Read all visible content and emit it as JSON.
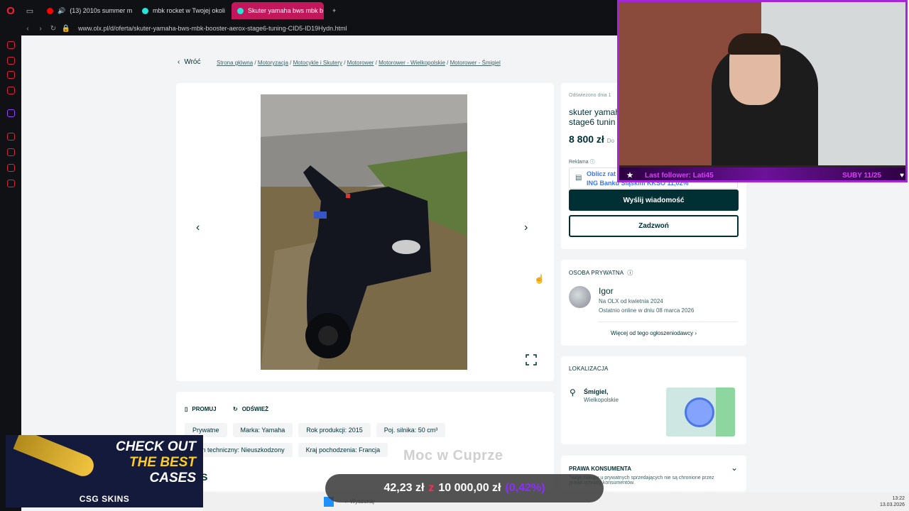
{
  "browser": {
    "tabs": [
      {
        "label": "(13) 2010s summer m",
        "color": "#ff0000",
        "active": false
      },
      {
        "label": "mbk rocket w Twojej okoli",
        "color": "#23e5db",
        "active": false
      },
      {
        "label": "Skuter yamaha bws mbk b",
        "color": "#23e5db",
        "active": true
      }
    ],
    "new_tab": "+",
    "url": "www.olx.pl/d/oferta/skuter-yamaha-bws-mbk-booster-aerox-stage6-tuning-CID5-ID19Hydn.html"
  },
  "listing": {
    "back": "Wróć",
    "breadcrumbs": [
      "Strona główna",
      "Motoryzacja",
      "Motocykle i Skutery",
      "Motorower",
      "Motorower - Wielkopolskie",
      "Motorower - Śmigiel"
    ],
    "refreshed": "Odświeżono dnia 1",
    "title": "skuter yamaha stage6 tunin",
    "price": "8 800 zł",
    "price_suffix": "Do",
    "ad_label": "Reklama",
    "ad_line1": "Oblicz rat",
    "ad_line2": "ING Banku Śląskim KKSO 11,02%",
    "send_message": "Wyślij wiadomość",
    "call": "Zadzwoń",
    "promote": "PROMUJ",
    "refresh": "ODŚWIEŻ",
    "tags": [
      "Prywatne",
      "Marka: Yamaha",
      "Rok produkcji: 2015",
      "Poj. silnika: 50 cm³",
      "Stan techniczny: Nieuszkodzony",
      "Kraj pochodzenia: Francja"
    ],
    "section_s": "S"
  },
  "seller": {
    "heading": "OSOBA PRYWATNA",
    "name": "Igor",
    "since": "Na OLX od kwietnia 2024",
    "online": "Ostatnio online w dniu 08 marca 2026",
    "more": "Więcej od tego ogłoszeniodawcy"
  },
  "location": {
    "heading": "LOKALIZACJA",
    "city": "Śmigiel,",
    "region": "Wielkopolskie"
  },
  "consumer": {
    "heading": "PRAWA KONSUMENTA",
    "text": "Twoje zakupy u prywatnych sprzedających nie są chronione przez prawa ochrony konsumentów."
  },
  "stream": {
    "follower": "Last follower: Lati45",
    "subs": "SUBY 11/25",
    "promo_line1": "CHECK OUT",
    "promo_line2": "THE BEST",
    "promo_line3": "CASES",
    "promo_brand": "CSG SKINS",
    "song": "Moc w Cuprze",
    "goal_current": "42,23 zł",
    "goal_of": "z",
    "goal_target": "10 000,00 zł",
    "goal_pct": "(0,42%)",
    "goal_progress": 0.0042
  },
  "taskbar": {
    "search": "Wyszukaj",
    "time": "13:22",
    "date": "13.03.2026"
  }
}
